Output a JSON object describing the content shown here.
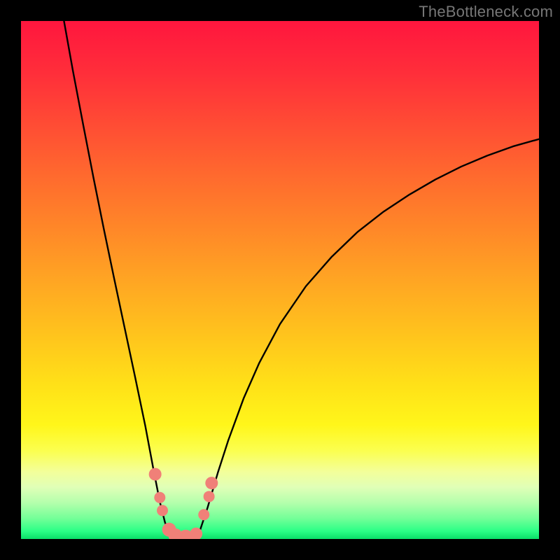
{
  "watermark": "TheBottleneck.com",
  "gradient": {
    "stops": [
      {
        "offset": 0.0,
        "color": "#ff163e"
      },
      {
        "offset": 0.1,
        "color": "#ff2e3a"
      },
      {
        "offset": 0.2,
        "color": "#ff4c34"
      },
      {
        "offset": 0.3,
        "color": "#ff6a2e"
      },
      {
        "offset": 0.4,
        "color": "#ff8728"
      },
      {
        "offset": 0.5,
        "color": "#ffa523"
      },
      {
        "offset": 0.6,
        "color": "#ffc21d"
      },
      {
        "offset": 0.7,
        "color": "#ffe018"
      },
      {
        "offset": 0.78,
        "color": "#fff61a"
      },
      {
        "offset": 0.83,
        "color": "#fbff50"
      },
      {
        "offset": 0.87,
        "color": "#f3ff9a"
      },
      {
        "offset": 0.9,
        "color": "#e0ffb7"
      },
      {
        "offset": 0.93,
        "color": "#b4ffac"
      },
      {
        "offset": 0.96,
        "color": "#74ff98"
      },
      {
        "offset": 0.985,
        "color": "#2bff86"
      },
      {
        "offset": 1.0,
        "color": "#0adf68"
      }
    ]
  },
  "chart_data": {
    "type": "line",
    "title": "",
    "xlabel": "",
    "ylabel": "",
    "xrange": [
      0,
      1
    ],
    "yrange": [
      0,
      1
    ],
    "description": "Bottleneck-style curve: y represents mismatch (1 at top = worst red, 0 at bottom = best green). Two branches meet near x≈0.30 at y≈0 forming a valley; left branch rises steeply to (0.08,1), right branch rises gradually toward (1.0,0.77).",
    "series": [
      {
        "name": "left-branch",
        "x": [
          0.083,
          0.1,
          0.12,
          0.14,
          0.16,
          0.18,
          0.2,
          0.22,
          0.24,
          0.255,
          0.268,
          0.278,
          0.29
        ],
        "y": [
          1.0,
          0.905,
          0.8,
          0.697,
          0.598,
          0.502,
          0.408,
          0.314,
          0.218,
          0.138,
          0.072,
          0.032,
          0.0
        ]
      },
      {
        "name": "valley-floor",
        "x": [
          0.29,
          0.34
        ],
        "y": [
          0.0,
          0.0
        ]
      },
      {
        "name": "right-branch",
        "x": [
          0.34,
          0.36,
          0.38,
          0.4,
          0.43,
          0.46,
          0.5,
          0.55,
          0.6,
          0.65,
          0.7,
          0.75,
          0.8,
          0.85,
          0.9,
          0.95,
          1.0
        ],
        "y": [
          0.0,
          0.06,
          0.128,
          0.19,
          0.272,
          0.34,
          0.415,
          0.488,
          0.545,
          0.593,
          0.632,
          0.665,
          0.694,
          0.719,
          0.74,
          0.758,
          0.772
        ]
      }
    ],
    "markers": [
      {
        "x": 0.259,
        "y": 0.125,
        "r": 9,
        "color": "#f08078"
      },
      {
        "x": 0.268,
        "y": 0.08,
        "r": 8,
        "color": "#f08078"
      },
      {
        "x": 0.273,
        "y": 0.055,
        "r": 8,
        "color": "#f08078"
      },
      {
        "x": 0.286,
        "y": 0.018,
        "r": 10,
        "color": "#f08078"
      },
      {
        "x": 0.298,
        "y": 0.007,
        "r": 10,
        "color": "#f08078"
      },
      {
        "x": 0.318,
        "y": 0.003,
        "r": 11,
        "color": "#f08078"
      },
      {
        "x": 0.338,
        "y": 0.01,
        "r": 9,
        "color": "#f08078"
      },
      {
        "x": 0.353,
        "y": 0.047,
        "r": 8,
        "color": "#f08078"
      },
      {
        "x": 0.363,
        "y": 0.082,
        "r": 8,
        "color": "#f08078"
      },
      {
        "x": 0.368,
        "y": 0.108,
        "r": 9,
        "color": "#f08078"
      }
    ]
  }
}
